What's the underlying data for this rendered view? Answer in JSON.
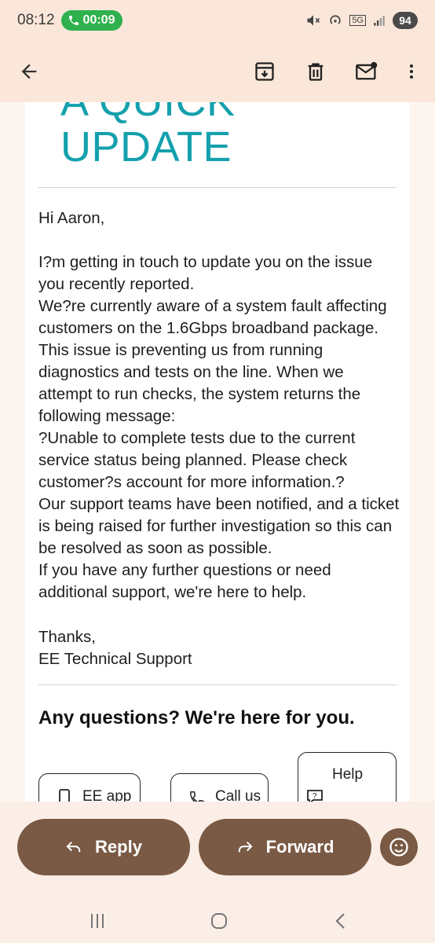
{
  "status_bar": {
    "time": "08:12",
    "call_timer": "00:09",
    "network": "5G",
    "battery": "94"
  },
  "app_bar": {
    "icons": [
      "back-arrow-icon",
      "archive-icon",
      "trash-icon",
      "mark-unread-icon",
      "more-vert-icon"
    ]
  },
  "email": {
    "hero_title_line1": "A QUICK",
    "hero_title_line2": "UPDATE",
    "greeting": "Hi Aaron,",
    "paragraphs": [
      "I?m getting in touch to update you on the issue you recently reported.",
      "We?re currently aware of a system fault affecting customers on the 1.6Gbps broadband package. This issue is preventing us from running diagnostics and tests on the line. When we attempt to run checks, the system returns the following message:",
      "?Unable to complete tests due to the current service status being planned. Please check customer?s account for more information.?",
      "Our support teams have been notified, and a ticket is being raised for further investigation so this can be resolved as soon as possible.",
      "If you have any further questions or need additional support, we're here to help."
    ],
    "signoff": "Thanks,",
    "signature": "EE Technical Support",
    "questions_title": "Any questions? We're here for you.",
    "contact_buttons": {
      "ee_app": "EE app",
      "call_us": "Call us",
      "help": "Help"
    }
  },
  "actions": {
    "reply": "Reply",
    "forward": "Forward"
  },
  "colors": {
    "accent_teal": "#14a0ad",
    "action_brown": "#7a5a45",
    "call_green": "#2fb14d"
  }
}
